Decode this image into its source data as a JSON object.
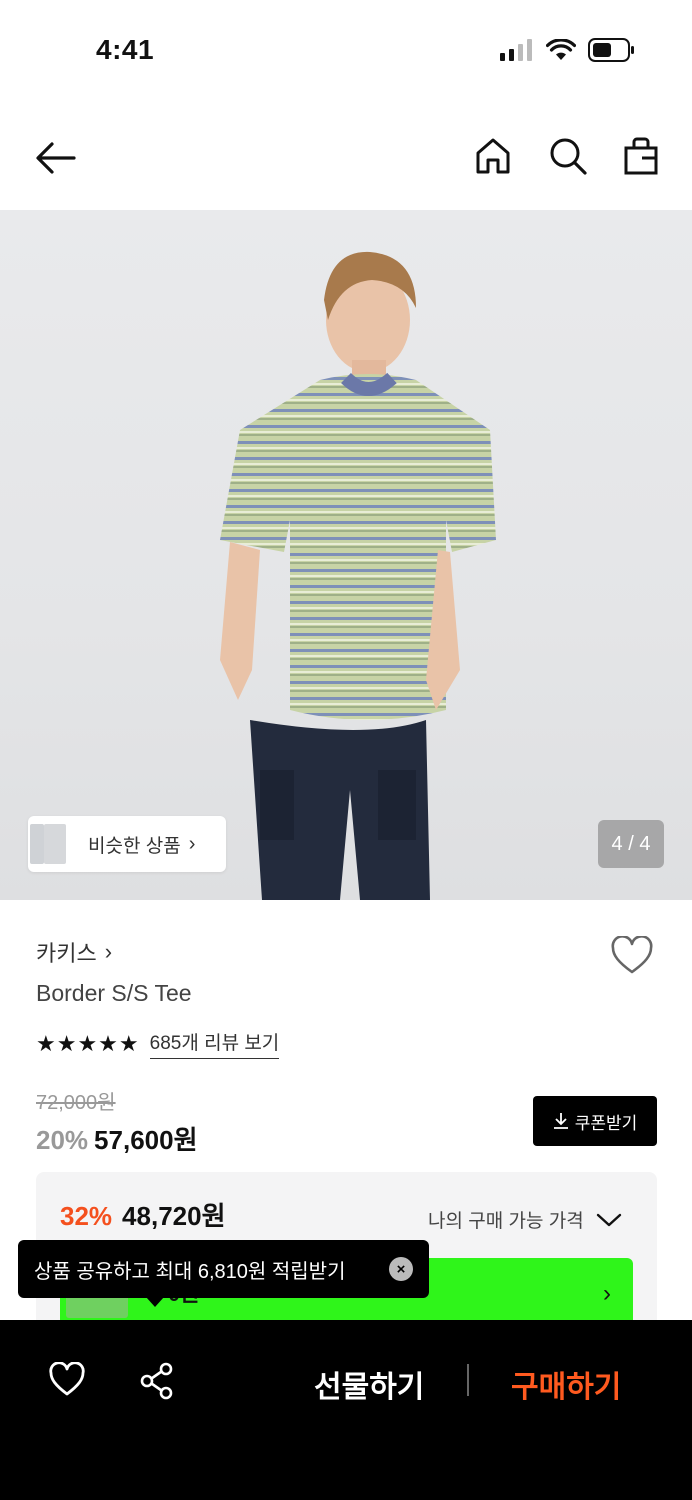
{
  "status_bar": {
    "time": "4:41"
  },
  "icons": {
    "back": "arrow-left-icon",
    "home": "home-icon",
    "search": "search-icon",
    "bag": "shopping-bag-icon",
    "wish": "heart-icon",
    "share": "share-icon"
  },
  "image": {
    "similar_label": "비슷한 상품",
    "similar_chevron": "›",
    "page_indicator": "4 / 4"
  },
  "product": {
    "brand": "카키스",
    "brand_chevron": "›",
    "name": "Border S/S Tee",
    "stars": "★★★★★",
    "rating": 5,
    "review_link": "685개 리뷰 보기",
    "original_price": "72,000원",
    "discount": "20%",
    "sale_price": "57,600원",
    "coupon_label": "쿠폰받기"
  },
  "benefit": {
    "best_discount": "32%",
    "best_price": "48,720원",
    "my_price_label": "나의 구매 가능 가격",
    "banner_text": "~0원",
    "banner_chevron": "›"
  },
  "tooltip": {
    "text": "상품 공유하고 최대 6,810원 적립받기",
    "close": "×"
  },
  "bottom_bar": {
    "gift_label": "선물하기",
    "buy_label": "구매하기"
  },
  "colors": {
    "accent_orange": "#ff5a1f",
    "discount_red": "#f4501e",
    "banner_green": "#2ff51a"
  }
}
